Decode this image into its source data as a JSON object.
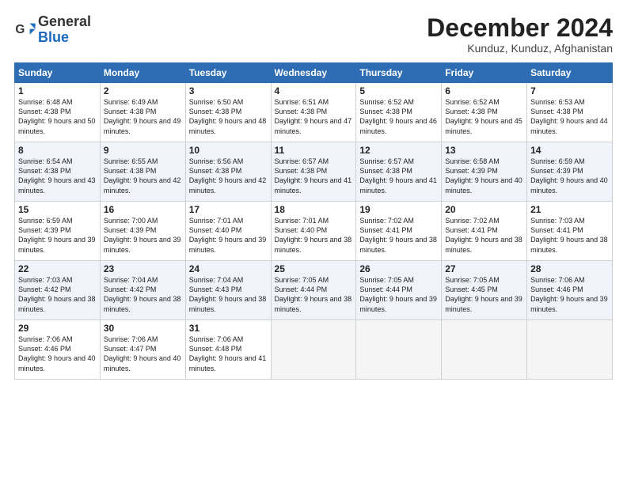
{
  "header": {
    "logo_line1": "General",
    "logo_line2": "Blue",
    "title": "December 2024",
    "subtitle": "Kunduz, Kunduz, Afghanistan"
  },
  "days_of_week": [
    "Sunday",
    "Monday",
    "Tuesday",
    "Wednesday",
    "Thursday",
    "Friday",
    "Saturday"
  ],
  "weeks": [
    [
      {
        "day": 1,
        "sunrise": "6:48 AM",
        "sunset": "4:38 PM",
        "daylight": "9 hours and 50 minutes."
      },
      {
        "day": 2,
        "sunrise": "6:49 AM",
        "sunset": "4:38 PM",
        "daylight": "9 hours and 49 minutes."
      },
      {
        "day": 3,
        "sunrise": "6:50 AM",
        "sunset": "4:38 PM",
        "daylight": "9 hours and 48 minutes."
      },
      {
        "day": 4,
        "sunrise": "6:51 AM",
        "sunset": "4:38 PM",
        "daylight": "9 hours and 47 minutes."
      },
      {
        "day": 5,
        "sunrise": "6:52 AM",
        "sunset": "4:38 PM",
        "daylight": "9 hours and 46 minutes."
      },
      {
        "day": 6,
        "sunrise": "6:52 AM",
        "sunset": "4:38 PM",
        "daylight": "9 hours and 45 minutes."
      },
      {
        "day": 7,
        "sunrise": "6:53 AM",
        "sunset": "4:38 PM",
        "daylight": "9 hours and 44 minutes."
      }
    ],
    [
      {
        "day": 8,
        "sunrise": "6:54 AM",
        "sunset": "4:38 PM",
        "daylight": "9 hours and 43 minutes."
      },
      {
        "day": 9,
        "sunrise": "6:55 AM",
        "sunset": "4:38 PM",
        "daylight": "9 hours and 42 minutes."
      },
      {
        "day": 10,
        "sunrise": "6:56 AM",
        "sunset": "4:38 PM",
        "daylight": "9 hours and 42 minutes."
      },
      {
        "day": 11,
        "sunrise": "6:57 AM",
        "sunset": "4:38 PM",
        "daylight": "9 hours and 41 minutes."
      },
      {
        "day": 12,
        "sunrise": "6:57 AM",
        "sunset": "4:38 PM",
        "daylight": "9 hours and 41 minutes."
      },
      {
        "day": 13,
        "sunrise": "6:58 AM",
        "sunset": "4:39 PM",
        "daylight": "9 hours and 40 minutes."
      },
      {
        "day": 14,
        "sunrise": "6:59 AM",
        "sunset": "4:39 PM",
        "daylight": "9 hours and 40 minutes."
      }
    ],
    [
      {
        "day": 15,
        "sunrise": "6:59 AM",
        "sunset": "4:39 PM",
        "daylight": "9 hours and 39 minutes."
      },
      {
        "day": 16,
        "sunrise": "7:00 AM",
        "sunset": "4:39 PM",
        "daylight": "9 hours and 39 minutes."
      },
      {
        "day": 17,
        "sunrise": "7:01 AM",
        "sunset": "4:40 PM",
        "daylight": "9 hours and 39 minutes."
      },
      {
        "day": 18,
        "sunrise": "7:01 AM",
        "sunset": "4:40 PM",
        "daylight": "9 hours and 38 minutes."
      },
      {
        "day": 19,
        "sunrise": "7:02 AM",
        "sunset": "4:41 PM",
        "daylight": "9 hours and 38 minutes."
      },
      {
        "day": 20,
        "sunrise": "7:02 AM",
        "sunset": "4:41 PM",
        "daylight": "9 hours and 38 minutes."
      },
      {
        "day": 21,
        "sunrise": "7:03 AM",
        "sunset": "4:41 PM",
        "daylight": "9 hours and 38 minutes."
      }
    ],
    [
      {
        "day": 22,
        "sunrise": "7:03 AM",
        "sunset": "4:42 PM",
        "daylight": "9 hours and 38 minutes."
      },
      {
        "day": 23,
        "sunrise": "7:04 AM",
        "sunset": "4:42 PM",
        "daylight": "9 hours and 38 minutes."
      },
      {
        "day": 24,
        "sunrise": "7:04 AM",
        "sunset": "4:43 PM",
        "daylight": "9 hours and 38 minutes."
      },
      {
        "day": 25,
        "sunrise": "7:05 AM",
        "sunset": "4:44 PM",
        "daylight": "9 hours and 38 minutes."
      },
      {
        "day": 26,
        "sunrise": "7:05 AM",
        "sunset": "4:44 PM",
        "daylight": "9 hours and 39 minutes."
      },
      {
        "day": 27,
        "sunrise": "7:05 AM",
        "sunset": "4:45 PM",
        "daylight": "9 hours and 39 minutes."
      },
      {
        "day": 28,
        "sunrise": "7:06 AM",
        "sunset": "4:46 PM",
        "daylight": "9 hours and 39 minutes."
      }
    ],
    [
      {
        "day": 29,
        "sunrise": "7:06 AM",
        "sunset": "4:46 PM",
        "daylight": "9 hours and 40 minutes."
      },
      {
        "day": 30,
        "sunrise": "7:06 AM",
        "sunset": "4:47 PM",
        "daylight": "9 hours and 40 minutes."
      },
      {
        "day": 31,
        "sunrise": "7:06 AM",
        "sunset": "4:48 PM",
        "daylight": "9 hours and 41 minutes."
      },
      null,
      null,
      null,
      null
    ]
  ]
}
